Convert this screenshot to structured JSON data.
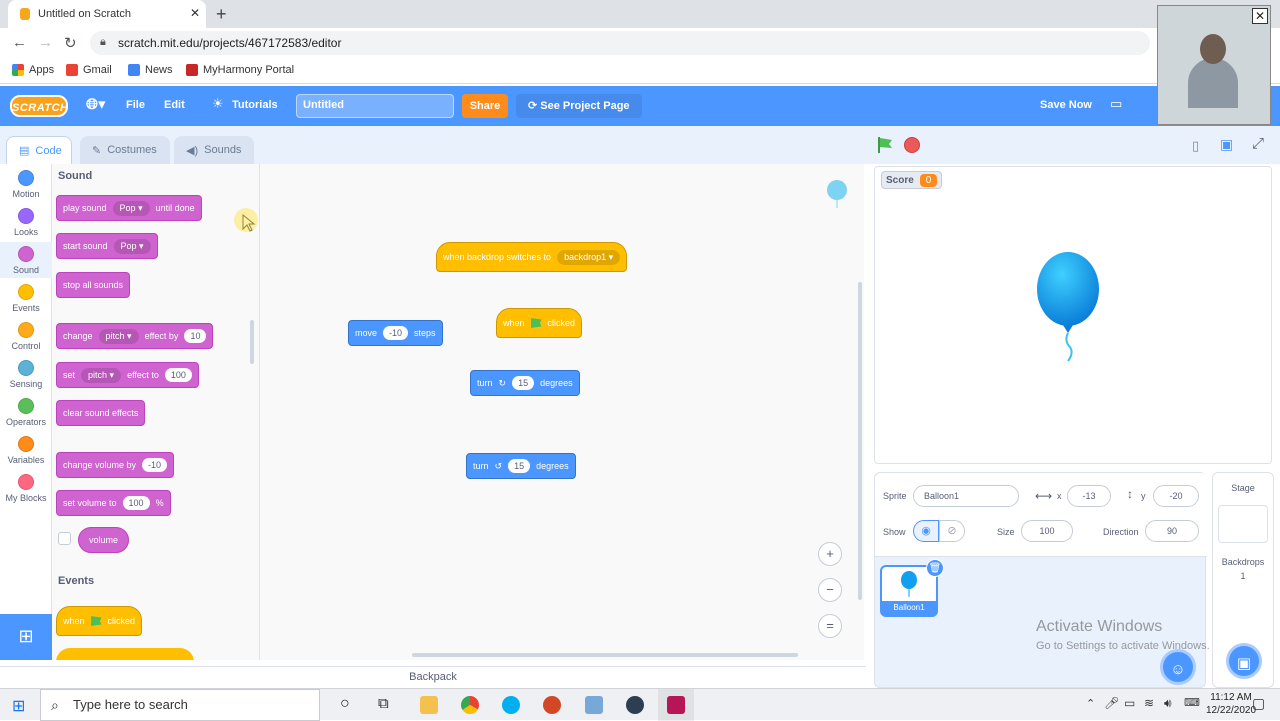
{
  "browser": {
    "tab_title": "Untitled on Scratch",
    "url": "scratch.mit.edu/projects/467172583/editor",
    "bookmarks": [
      "Apps",
      "Gmail",
      "News",
      "MyHarmony Portal"
    ]
  },
  "menubar": {
    "logo": "SCRATCH",
    "file": "File",
    "edit": "Edit",
    "tutorials": "Tutorials",
    "project_title": "Untitled",
    "share": "Share",
    "see_project": "See Project Page",
    "save_now": "Save Now",
    "accent": "#4c97ff"
  },
  "editor_tabs": {
    "code": "Code",
    "costumes": "Costumes",
    "sounds": "Sounds"
  },
  "categories": [
    {
      "label": "Motion",
      "color": "#4c97ff"
    },
    {
      "label": "Looks",
      "color": "#9966ff"
    },
    {
      "label": "Sound",
      "color": "#cf63cf"
    },
    {
      "label": "Events",
      "color": "#ffbf00"
    },
    {
      "label": "Control",
      "color": "#ffab19"
    },
    {
      "label": "Sensing",
      "color": "#5cb1d6"
    },
    {
      "label": "Operators",
      "color": "#59c059"
    },
    {
      "label": "Variables",
      "color": "#ff8c1a"
    },
    {
      "label": "My Blocks",
      "color": "#ff6680"
    }
  ],
  "palette": {
    "sound_title": "Sound",
    "events_title": "Events",
    "play_sound": {
      "a": "play sound",
      "b": "Pop",
      "c": "until done"
    },
    "start_sound": {
      "a": "start sound",
      "b": "Pop"
    },
    "stop_all": "stop all sounds",
    "change_effect": {
      "a": "change",
      "b": "pitch",
      "c": "effect by",
      "d": "10"
    },
    "set_effect": {
      "a": "set",
      "b": "pitch",
      "c": "effect to",
      "d": "100"
    },
    "clear_effects": "clear sound effects",
    "change_volume": {
      "a": "change volume by",
      "b": "-10"
    },
    "set_volume": {
      "a": "set volume to",
      "b": "100",
      "c": "%"
    },
    "volume": "volume",
    "when_clicked": {
      "a": "when",
      "b": "clicked"
    }
  },
  "scripts": {
    "backdrop_hat": {
      "a": "when backdrop switches to",
      "b": "backdrop1"
    },
    "move": {
      "a": "move",
      "b": "-10",
      "c": "steps"
    },
    "flag_hat": {
      "a": "when",
      "b": "clicked"
    },
    "turn_right": {
      "a": "turn",
      "b": "15",
      "c": "degrees"
    },
    "turn_left": {
      "a": "turn",
      "b": "15",
      "c": "degrees"
    },
    "zoom_in": "+",
    "zoom_out": "−",
    "zoom_reset": "="
  },
  "backpack": "Backpack",
  "stage": {
    "score_label": "Score",
    "score_value": "0"
  },
  "sprite_info": {
    "sprite_label": "Sprite",
    "sprite_name": "Balloon1",
    "x_label": "x",
    "x_value": "-13",
    "y_label": "y",
    "y_value": "-20",
    "show_label": "Show",
    "size_label": "Size",
    "size_value": "100",
    "direction_label": "Direction",
    "direction_value": "90",
    "tile_name": "Balloon1"
  },
  "stage_pane": {
    "title": "Stage",
    "backdrops_label": "Backdrops",
    "backdrops_count": "1"
  },
  "watermark": {
    "line1": "Activate Windows",
    "line2": "Go to Settings to activate Windows."
  },
  "taskbar": {
    "search_placeholder": "Type here to search",
    "time": "11:12 AM",
    "date": "12/22/2020"
  }
}
